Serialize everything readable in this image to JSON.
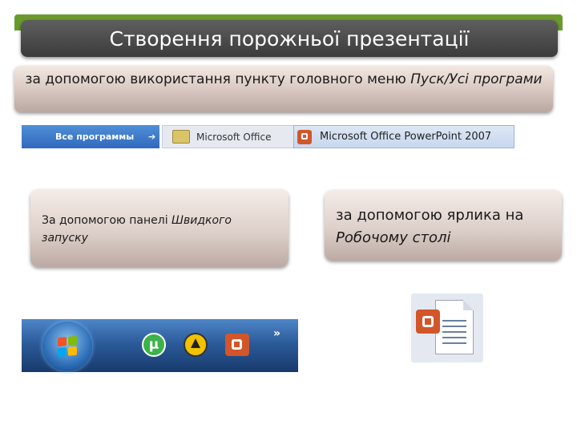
{
  "slide": {
    "title": "Створення порожньої презентації",
    "subtitle_plain": "за допомогою використання пункту головного меню ",
    "subtitle_italic": "Пуск/Усі програми"
  },
  "start_menu": {
    "all_programs": "Все программы",
    "arrow": "➔",
    "folder": "Microsoft Office",
    "app": "Microsoft Office PowerPoint 2007"
  },
  "quick_launch_card": {
    "plain": "За допомогою панелі ",
    "italic": "Швидкого запуску"
  },
  "desktop_card": {
    "plain": "за допомогою ярлика на ",
    "italic": "Робочому столі"
  },
  "taskbar": {
    "icons": [
      "windows-start-orb",
      "utorrent-icon",
      "aim-icon",
      "powerpoint-icon"
    ],
    "more": "»"
  },
  "colors": {
    "title_bar": "#4a4a4a",
    "accent_green": "#6a9a2c",
    "card": "#d6c6bf",
    "taskbar": "#2c5b9a",
    "powerpoint": "#d2562a"
  }
}
